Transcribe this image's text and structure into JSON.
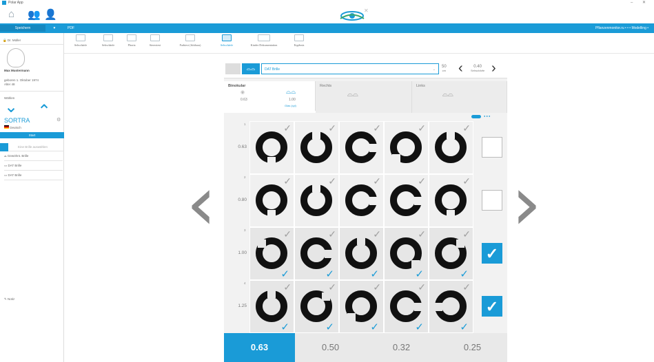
{
  "window": {
    "title": "Polar App",
    "controls": "– ✕"
  },
  "top": {
    "home_icon": "home-icon",
    "users_icon": "users-icon",
    "add_user_icon": "add-user-icon",
    "logo_icon": "eye-logo-icon"
  },
  "bluebar": {
    "left_label": "Speichern",
    "pdf_label": "PDF",
    "right_label": "Pflanzenmonitor.ru • • • Modelling  •"
  },
  "tools": [
    {
      "label": "Sehschärfe"
    },
    {
      "label": "Sehschärfe"
    },
    {
      "label": "Phoria"
    },
    {
      "label": "Stereotest"
    },
    {
      "label": "Farbtest (Ishihara)"
    },
    {
      "label": "Sehschärfe"
    },
    {
      "label": "Kinder Dokumentation"
    },
    {
      "label": "Ergebnis"
    }
  ],
  "sidebar": {
    "doctor": "Dr. Müller",
    "patient_name": "Max Mustermann",
    "patient_dob": "geboren 1. Oktober 1974",
    "patient_age": "Alter 48",
    "nav_label": "Wählen",
    "brand": "SORTRA",
    "language": "Deutsch",
    "start_button": "Start",
    "select_placeholder": "Eine Brille auswählen",
    "items": [
      {
        "label": "Gewöhnt. Brille"
      },
      {
        "label": "DAT Brille"
      },
      {
        "label": "DAT Brille"
      }
    ],
    "bottom_label": "Notiz"
  },
  "optobar": {
    "dropdown_value": "DAT Brille",
    "distance": "50",
    "distance_unit": "cm",
    "value": "0.40",
    "value_unit": "Sehschärfe"
  },
  "tabs": [
    {
      "label": "Binokular",
      "left_value": "0.63",
      "right_value": "1.00",
      "sub_label": "Glas (cyl)"
    },
    {
      "label": "Rechts"
    },
    {
      "label": "Links"
    }
  ],
  "rows": [
    {
      "num": "1",
      "acuity": "0.63",
      "checked": false
    },
    {
      "num": "2",
      "acuity": "0.80",
      "checked": false
    },
    {
      "num": "3",
      "acuity": "1.00",
      "checked": true
    },
    {
      "num": "4",
      "acuity": "1.25",
      "checked": true
    }
  ],
  "bottom": [
    {
      "label": "0.63"
    },
    {
      "label": "0.50"
    },
    {
      "label": "0.32"
    },
    {
      "label": "0.25"
    }
  ],
  "colors": {
    "accent": "#1a9bd7",
    "gray_arrow": "#8a8a8a"
  }
}
